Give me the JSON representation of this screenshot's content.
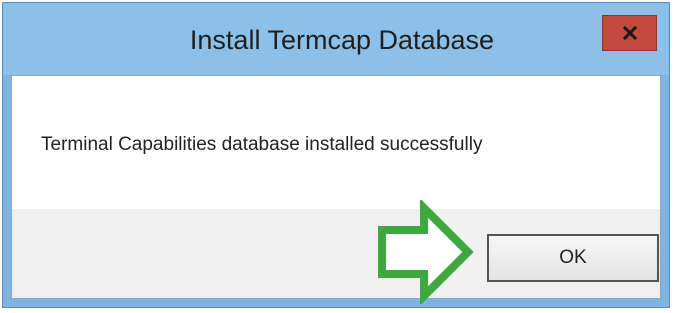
{
  "window": {
    "title": "Install Termcap Database",
    "close_icon": "close-icon",
    "accent_colors": {
      "title_bar": "#8cc0e8",
      "close_button": "#c24a3c",
      "annotation_arrow": "#3ea83e"
    }
  },
  "message": {
    "text": "Terminal Capabilities database installed successfully"
  },
  "buttons": {
    "ok_label": "OK"
  },
  "annotation": {
    "icon": "right-arrow-icon"
  }
}
